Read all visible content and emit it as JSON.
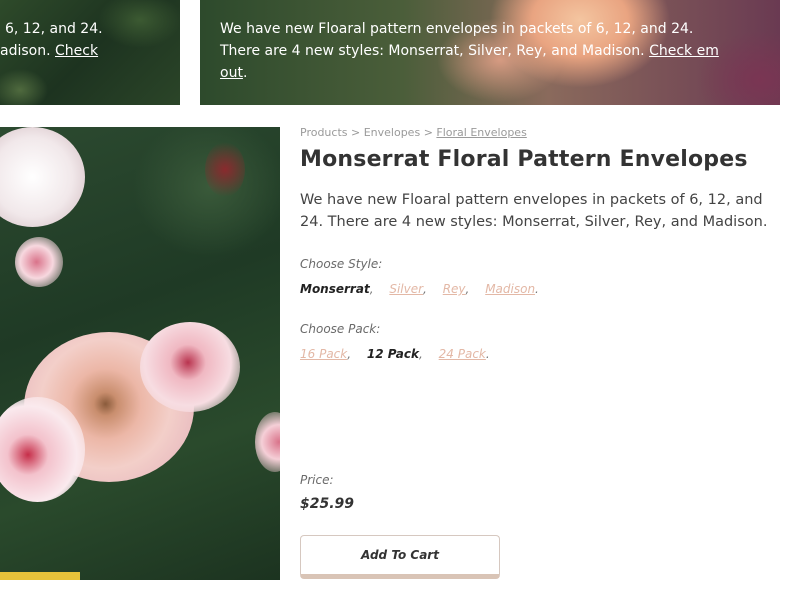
{
  "banner_left": {
    "line1": "6, 12, and 24.",
    "line2_prefix": "adison.",
    "line2_link": "Check"
  },
  "banner_right": {
    "text": "We have new Floaral pattern envelopes in packets of 6, 12, and 24. There are 4 new styles: Monserrat, Silver, Rey, and Madison.",
    "link": "Check em out"
  },
  "breadcrumb": {
    "items": [
      "Products",
      "Envelopes"
    ],
    "current": "Floral Envelopes",
    "separator": ">"
  },
  "product": {
    "title": "Monserrat Floral Pattern Envelopes",
    "description": "We have new Floaral pattern envelopes in packets of 6, 12, and 24. There are 4 new styles: Monserrat, Silver, Rey, and Madison.",
    "style_label": "Choose Style:",
    "styles": [
      {
        "label": "Monserrat",
        "selected": true
      },
      {
        "label": "Silver",
        "selected": false
      },
      {
        "label": "Rey",
        "selected": false
      },
      {
        "label": "Madison",
        "selected": false
      }
    ],
    "pack_label": "Choose Pack:",
    "packs": [
      {
        "label": "16 Pack",
        "selected": false
      },
      {
        "label": "12 Pack",
        "selected": true
      },
      {
        "label": "24 Pack",
        "selected": false
      }
    ],
    "price_label": "Price:",
    "price": "$25.99",
    "add_to_cart": "Add To Cart"
  },
  "colors": {
    "link_accent": "#e3b8a6",
    "button_border": "#d9c4b6"
  }
}
